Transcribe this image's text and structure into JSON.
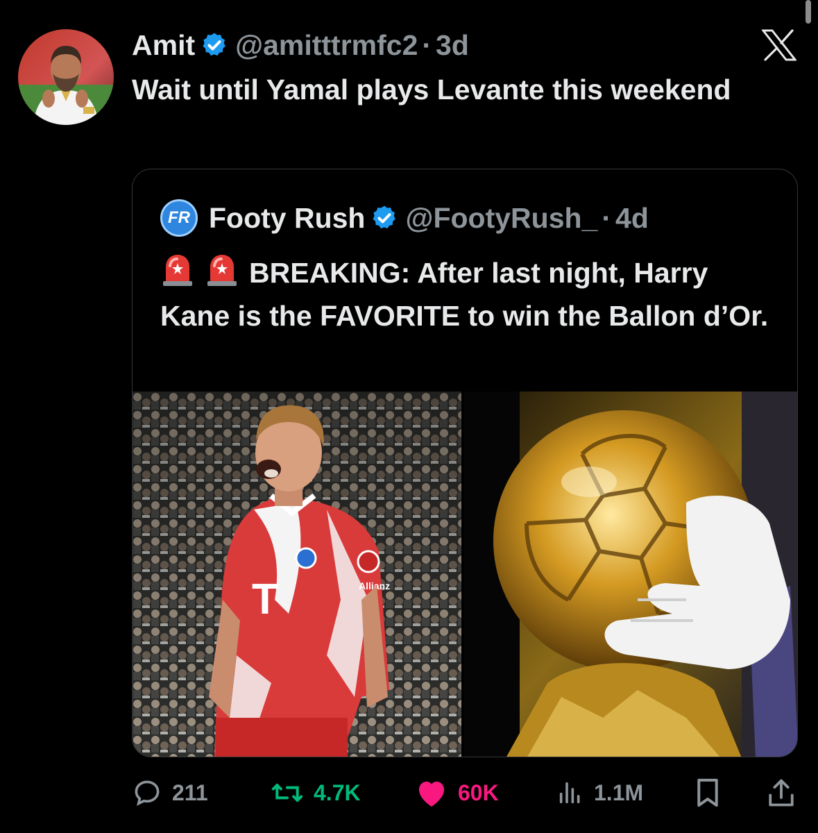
{
  "tweet": {
    "author_name": "Amit",
    "handle": "@amitttrmfc2",
    "separator": "·",
    "age": "3d",
    "text": "Wait until Yamal plays Levante this weekend"
  },
  "quoted": {
    "logo_text": "FR",
    "author_name": "Footy Rush",
    "handle": "@FootyRush_",
    "separator": "·",
    "age": "4d",
    "text": "BREAKING: After last night, Harry Kane is the FAVORITE to win the Ballon d’Or.",
    "jersey_sponsor": "T",
    "jersey_sleeve_text": "Allianz"
  },
  "actions": {
    "replies": "211",
    "reposts": "4.7K",
    "likes": "60K",
    "views": "1.1M"
  },
  "icons": {
    "verified": "verified-badge-icon",
    "x_logo": "x-logo-icon",
    "siren": "police-light-emoji",
    "reply": "reply-icon",
    "repost": "repost-icon",
    "like": "heart-icon",
    "views": "views-icon",
    "bookmark": "bookmark-icon",
    "share": "share-icon"
  },
  "colors": {
    "background": "#000000",
    "text": "#e7e9ea",
    "muted": "#8d949a",
    "verified": "#1d9bf0",
    "repost": "#00ba7c",
    "like": "#f91880"
  }
}
